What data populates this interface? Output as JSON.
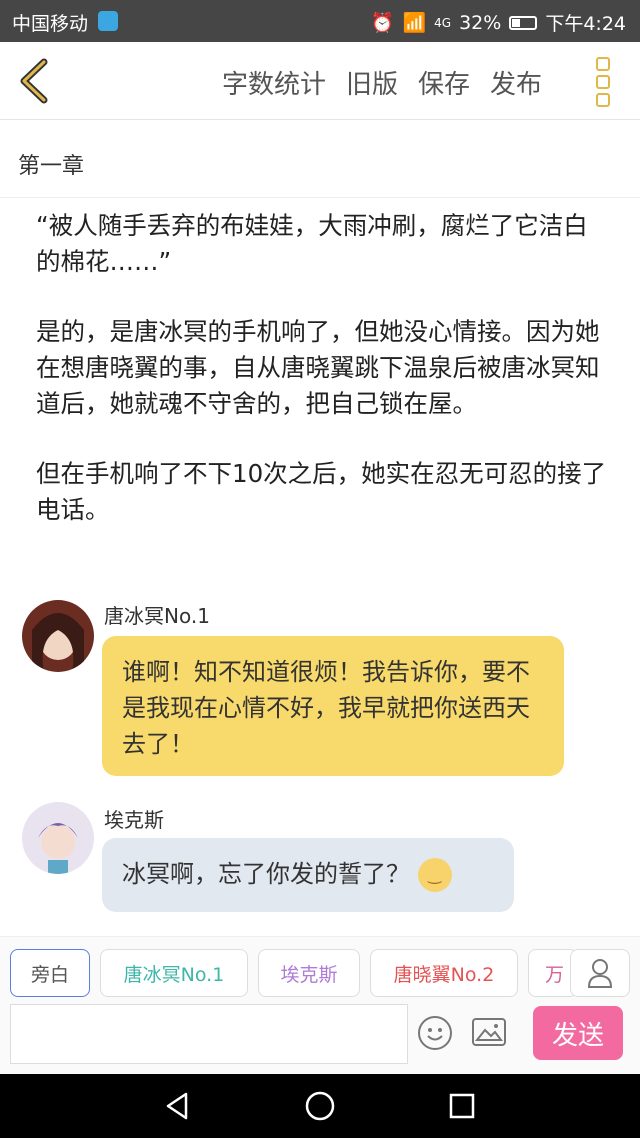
{
  "status_bar": {
    "carrier": "中国移动",
    "network": "4G",
    "battery": "32%",
    "time": "下午4:24"
  },
  "toolbar": {
    "actions": [
      "字数统计",
      "旧版",
      "保存",
      "发布"
    ]
  },
  "chapter": {
    "title": "第一章"
  },
  "content": {
    "paragraphs": [
      "“被人随手丢弃的布娃娃，大雨冲刷，腐烂了它洁白的棉花……”",
      "是的，是唐冰冥的手机响了，但她没心情接。因为她在想唐晓翼的事，自从唐晓翼跳下温泉后被唐冰冥知道后，她就魂不守舍的，把自己锁在屋。",
      "但在手机响了不下10次之后，她实在忍无可忍的接了电话。"
    ]
  },
  "messages": [
    {
      "name": "唐冰冥No.1",
      "text": "谁啊！知不知道很烦！我告诉你，要不是我现在心情不好，我早就把你送西天去了！"
    },
    {
      "name": "埃克斯",
      "text": "冰冥啊，忘了你发的誓了？"
    }
  ],
  "roles": [
    {
      "label": "旁白",
      "color": "#555555"
    },
    {
      "label": "唐冰冥No.1",
      "color": "#3cb7a8"
    },
    {
      "label": "埃克斯",
      "color": "#b07bd8"
    },
    {
      "label": "唐晓翼No.2",
      "color": "#e45454"
    },
    {
      "label": "万",
      "color": "#d9609a"
    }
  ],
  "input": {
    "placeholder": "",
    "send_label": "发送"
  },
  "colors": {
    "accent_yellow": "#f7da6b",
    "send_pink": "#f36aa0",
    "bubble_gray": "#e2e8f0"
  }
}
